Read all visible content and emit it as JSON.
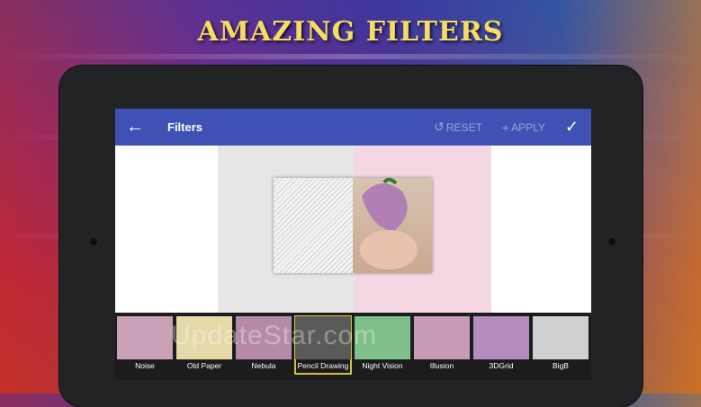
{
  "headline": "AMAZING FILTERS",
  "appbar": {
    "title": "Filters",
    "reset_label": "RESET",
    "apply_label": "APPLY"
  },
  "filters": [
    {
      "label": "Noise",
      "tint": "#c9a0b5"
    },
    {
      "label": "Old Paper",
      "tint": "#e6d9a8"
    },
    {
      "label": "Nebula",
      "tint": "#b48aa8"
    },
    {
      "label": "Pencil Drawing",
      "tint": "#5a5a5a"
    },
    {
      "label": "Night Vision",
      "tint": "#7fbf8a"
    },
    {
      "label": "Illusion",
      "tint": "#c79ab8"
    },
    {
      "label": "3DGrid",
      "tint": "#b38cc0"
    },
    {
      "label": "BigB",
      "tint": "#d0d0d0"
    }
  ],
  "selected_filter": "Pencil Drawing",
  "watermark": "UpdateStar.com",
  "colors": {
    "appbar": "#3f51b5",
    "headline": "#f6dc64",
    "selected_outline": "#d4c23c"
  }
}
